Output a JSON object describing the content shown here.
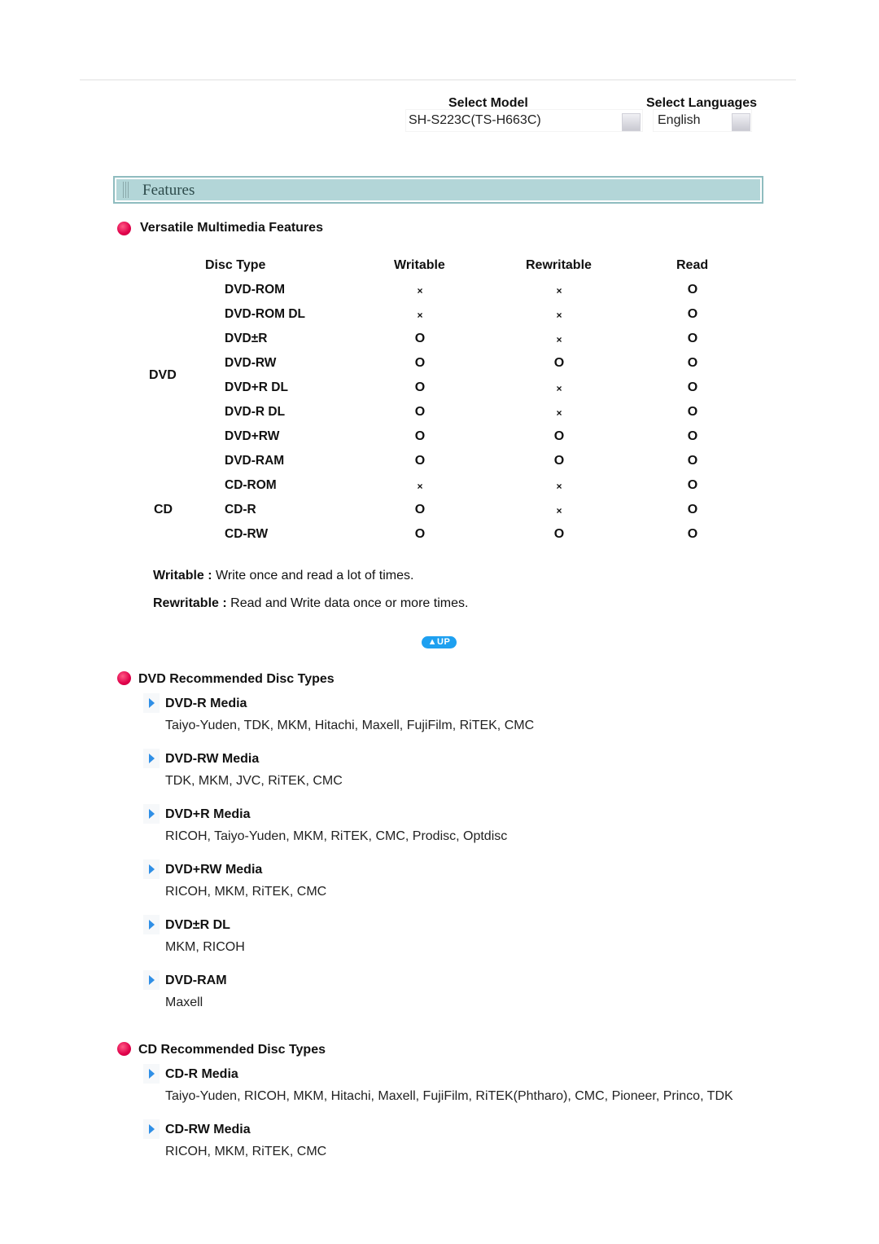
{
  "header": {
    "select_model_label": "Select Model",
    "select_model_value": "SH-S223C(TS-H663C)",
    "select_languages_label": "Select Languages",
    "select_languages_value": "English"
  },
  "features": {
    "banner_title": "Features",
    "versatile_title": "Versatile Multimedia Features",
    "table": {
      "headers": [
        "Disc Type",
        "Writable",
        "Rewritable",
        "Read"
      ],
      "groups": [
        {
          "label": "DVD"
        },
        {
          "label": "CD"
        }
      ],
      "rows": [
        {
          "type": "DVD-ROM",
          "writable": "×",
          "rewritable": "×",
          "read": "O"
        },
        {
          "type": "DVD-ROM DL",
          "writable": "×",
          "rewritable": "×",
          "read": "O"
        },
        {
          "type": "DVD±R",
          "writable": "O",
          "rewritable": "×",
          "read": "O"
        },
        {
          "type": "DVD-RW",
          "writable": "O",
          "rewritable": "O",
          "read": "O"
        },
        {
          "type": "DVD+R DL",
          "writable": "O",
          "rewritable": "×",
          "read": "O"
        },
        {
          "type": "DVD-R DL",
          "writable": "O",
          "rewritable": "×",
          "read": "O"
        },
        {
          "type": "DVD+RW",
          "writable": "O",
          "rewritable": "O",
          "read": "O"
        },
        {
          "type": "DVD-RAM",
          "writable": "O",
          "rewritable": "O",
          "read": "O"
        },
        {
          "type": "CD-ROM",
          "writable": "×",
          "rewritable": "×",
          "read": "O"
        },
        {
          "type": "CD-R",
          "writable": "O",
          "rewritable": "×",
          "read": "O"
        },
        {
          "type": "CD-RW",
          "writable": "O",
          "rewritable": "O",
          "read": "O"
        }
      ]
    },
    "notes": [
      {
        "term": "Writable :",
        "text": " Write once and read a lot of times."
      },
      {
        "term": "Rewritable :",
        "text": " Read and Write data once or more times."
      }
    ],
    "up_button_label": "▲UP"
  },
  "dvd_recommended": {
    "title": "DVD Recommended Disc Types",
    "items": [
      {
        "title": "DVD-R Media",
        "text": "Taiyo-Yuden, TDK, MKM, Hitachi, Maxell, FujiFilm, RiTEK, CMC"
      },
      {
        "title": "DVD-RW Media",
        "text": "TDK, MKM, JVC, RiTEK, CMC"
      },
      {
        "title": "DVD+R Media",
        "text": "RICOH, Taiyo-Yuden, MKM, RiTEK, CMC, Prodisc, Optdisc"
      },
      {
        "title": "DVD+RW Media",
        "text": "RICOH, MKM, RiTEK, CMC"
      },
      {
        "title": "DVD±R DL",
        "text": "MKM, RICOH"
      },
      {
        "title": "DVD-RAM",
        "text": "Maxell"
      }
    ]
  },
  "cd_recommended": {
    "title": "CD Recommended Disc Types",
    "items": [
      {
        "title": "CD-R Media",
        "text": "Taiyo-Yuden, RICOH, MKM, Hitachi, Maxell, FujiFilm, RiTEK(Phtharo), CMC, Pioneer, Princo, TDK"
      },
      {
        "title": "CD-RW Media",
        "text": "RICOH, MKM, RiTEK, CMC"
      }
    ]
  },
  "colors": {
    "bullet": "#e0004a",
    "arrow": "#2f8fe6",
    "banner_bg": "#b3d6d8",
    "banner_border": "#8fbcbf",
    "up_button": "#1ea0f0"
  }
}
